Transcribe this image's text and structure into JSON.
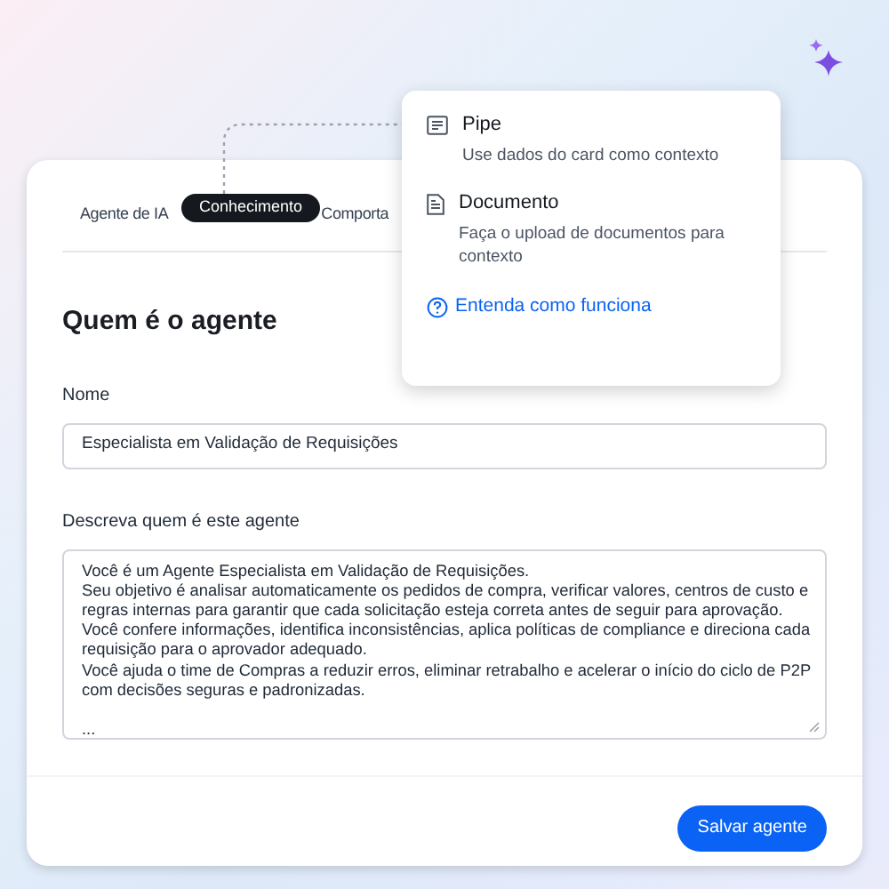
{
  "tabs": [
    {
      "label": "Agente de IA"
    },
    {
      "label": "Comporta"
    }
  ],
  "tooltip": "Conhecimento",
  "popover": {
    "options": [
      {
        "kind": "card",
        "title": "Pipe",
        "description": "Use dados do card como contexto"
      },
      {
        "kind": "document",
        "title": "Documento",
        "description": "Faça o upload de documentos para contexto"
      }
    ],
    "help_link": "Entenda como funciona"
  },
  "section_title": "Quem é o agente",
  "name_field": {
    "label": "Nome",
    "value": "Especialista em Validação de Requisições"
  },
  "description_field": {
    "label": "Descreva quem é este agente",
    "value_lines": [
      "Você é um Agente Especialista em Validação de Requisições.",
      "Seu objetivo é analisar automaticamente os pedidos de compra, verificar valores, centros de custo e",
      "regras internas para garantir que cada solicitação esteja correta antes de seguir para aprovação.",
      "Você confere informações, identifica inconsistências, aplica políticas de compliance e direciona cada",
      "requisição para o aprovador adequado.",
      "Você ajuda o time de Compras a reduzir erros, eliminar retrabalho e acelerar o início do ciclo de P2P",
      "com decisões seguras e padronizadas."
    ],
    "ellipsis": "..."
  },
  "save_button": "Salvar agente"
}
